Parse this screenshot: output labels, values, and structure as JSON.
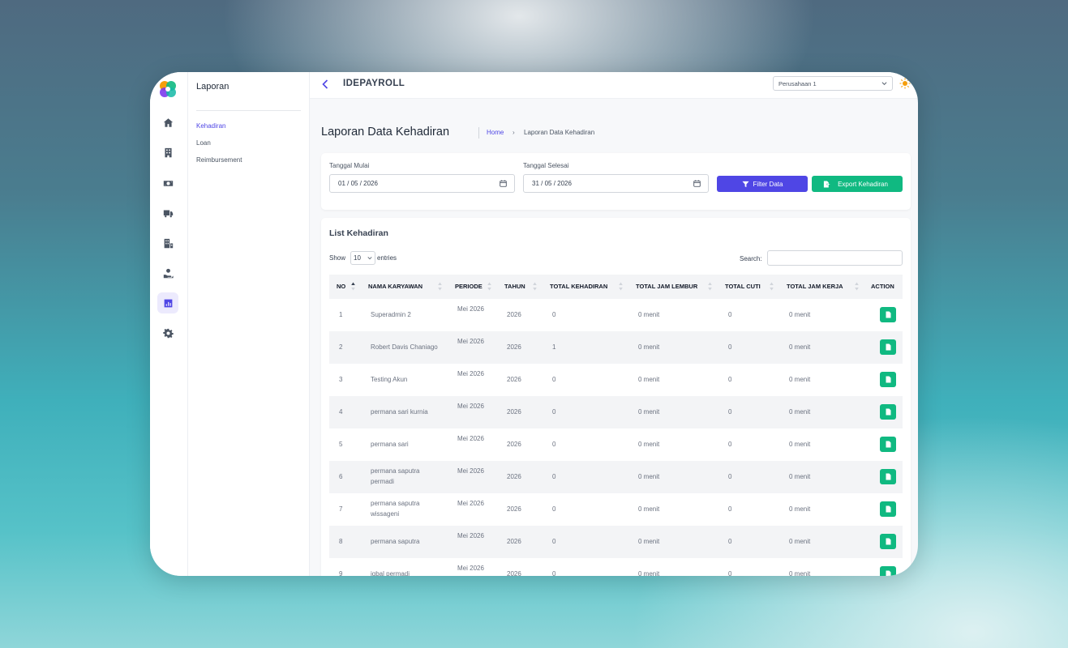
{
  "app": {
    "title": "IDEPAYROLL",
    "company": "Perusahaan 1"
  },
  "submenu": {
    "title": "Laporan",
    "items": [
      {
        "label": "Kehadiran",
        "active": true
      },
      {
        "label": "Loan",
        "active": false
      },
      {
        "label": "Reimbursement",
        "active": false
      }
    ]
  },
  "rail_icons": [
    "home-icon",
    "building-icon",
    "money-icon",
    "truck-icon",
    "office-icon",
    "hand-coin-icon",
    "chart-icon",
    "gear-icon"
  ],
  "page": {
    "title": "Laporan Data Kehadiran",
    "breadcrumb": {
      "home": "Home",
      "current": "Laporan Data Kehadiran"
    }
  },
  "filter": {
    "start_label": "Tanggal Mulai",
    "start_value": "01 / 05 / 2026",
    "end_label": "Tanggal Selesai",
    "end_value": "31 / 05 / 2026",
    "filter_button": "Filter Data",
    "export_button": "Export Kehadiran"
  },
  "list": {
    "title": "List Kehadiran",
    "show_label": "Show",
    "entries_value": "10",
    "entries_label": "entries",
    "search_label": "Search:",
    "columns": [
      "NO",
      "NAMA KARYAWAN",
      "PERIODE",
      "TAHUN",
      "TOTAL KEHADIRAN",
      "TOTAL JAM LEMBUR",
      "TOTAL CUTI",
      "TOTAL JAM KERJA",
      "ACTION"
    ],
    "rows": [
      {
        "no": "1",
        "name": "Superadmin 2",
        "periode": "Mei 2026",
        "tahun": "2026",
        "kehadiran": "0",
        "lembur": "0 menit",
        "cuti": "0",
        "kerja": "0 menit"
      },
      {
        "no": "2",
        "name": "Robert Davis Chaniago",
        "periode": "Mei 2026",
        "tahun": "2026",
        "kehadiran": "1",
        "lembur": "0 menit",
        "cuti": "0",
        "kerja": "0 menit"
      },
      {
        "no": "3",
        "name": "Testing Akun",
        "periode": "Mei 2026",
        "tahun": "2026",
        "kehadiran": "0",
        "lembur": "0 menit",
        "cuti": "0",
        "kerja": "0 menit"
      },
      {
        "no": "4",
        "name": "permana sari kurnia",
        "periode": "Mei 2026",
        "tahun": "2026",
        "kehadiran": "0",
        "lembur": "0 menit",
        "cuti": "0",
        "kerja": "0 menit"
      },
      {
        "no": "5",
        "name": "permana sari",
        "periode": "Mei 2026",
        "tahun": "2026",
        "kehadiran": "0",
        "lembur": "0 menit",
        "cuti": "0",
        "kerja": "0 menit"
      },
      {
        "no": "6",
        "name": "permana saputra permadi",
        "periode": "Mei 2026",
        "tahun": "2026",
        "kehadiran": "0",
        "lembur": "0 menit",
        "cuti": "0",
        "kerja": "0 menit"
      },
      {
        "no": "7",
        "name": "permana saputra wissageni",
        "periode": "Mei 2026",
        "tahun": "2026",
        "kehadiran": "0",
        "lembur": "0 menit",
        "cuti": "0",
        "kerja": "0 menit"
      },
      {
        "no": "8",
        "name": "permana saputra",
        "periode": "Mei 2026",
        "tahun": "2026",
        "kehadiran": "0",
        "lembur": "0 menit",
        "cuti": "0",
        "kerja": "0 menit"
      },
      {
        "no": "9",
        "name": "iqbal permadi",
        "periode": "Mei 2026",
        "tahun": "2026",
        "kehadiran": "0",
        "lembur": "0 menit",
        "cuti": "0",
        "kerja": "0 menit"
      }
    ]
  },
  "colors": {
    "primary": "#4f46e5",
    "success": "#10b981"
  }
}
